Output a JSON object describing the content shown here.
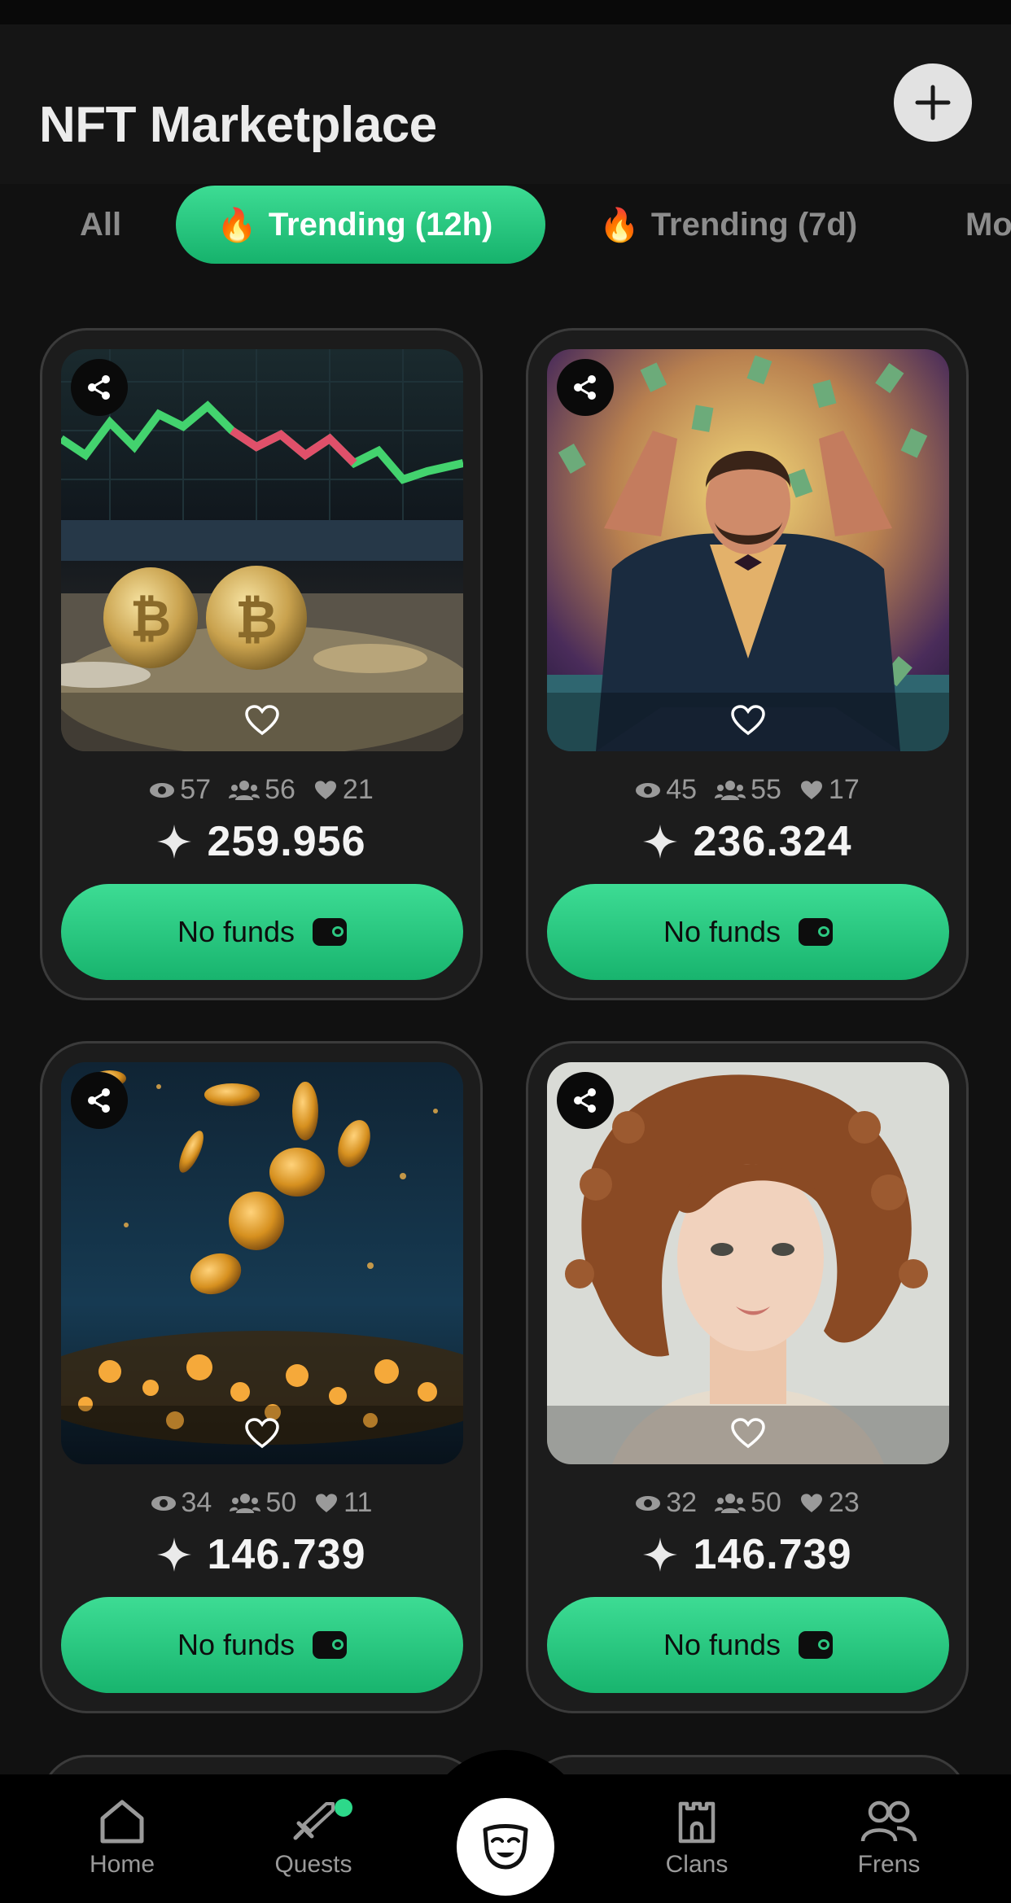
{
  "header": {
    "title": "NFT Marketplace"
  },
  "tabs": [
    {
      "label": "All",
      "flame": false,
      "active": false
    },
    {
      "label": "Trending (12h)",
      "flame": true,
      "active": true
    },
    {
      "label": "Trending (7d)",
      "flame": true,
      "active": false
    },
    {
      "label": "Mo",
      "flame": false,
      "active": false
    }
  ],
  "cards": [
    {
      "image": "bitcoin-coins-trading-chart",
      "views": "57",
      "holders": "56",
      "likes": "21",
      "price": "259.956",
      "button": "No funds"
    },
    {
      "image": "man-with-flying-money",
      "views": "45",
      "holders": "55",
      "likes": "17",
      "price": "236.324",
      "button": "No funds"
    },
    {
      "image": "falling-gold-coins",
      "views": "34",
      "holders": "50",
      "likes": "11",
      "price": "146.739",
      "button": "No funds"
    },
    {
      "image": "curly-haired-woman-portrait",
      "views": "32",
      "holders": "50",
      "likes": "23",
      "price": "146.739",
      "button": "No funds"
    }
  ],
  "nav": [
    {
      "label": "Home",
      "icon": "home-icon"
    },
    {
      "label": "Quests",
      "icon": "sword-icon"
    },
    {
      "label": "",
      "icon": "mask-icon"
    },
    {
      "label": "Clans",
      "icon": "castle-icon"
    },
    {
      "label": "Frens",
      "icon": "friends-icon"
    }
  ],
  "colors": {
    "accent": "#2dd98a",
    "background": "#111111",
    "card": "#1c1c1c"
  }
}
